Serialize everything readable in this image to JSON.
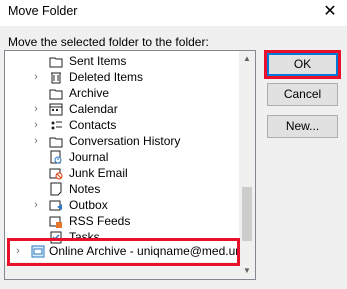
{
  "window": {
    "title": "Move Folder",
    "close_glyph": "✕"
  },
  "instruction": "Move the selected folder to the folder:",
  "folders": [
    {
      "label": "Sent Items",
      "icon": "folder-icon",
      "expandable": false
    },
    {
      "label": "Deleted Items",
      "icon": "trash-folder-icon",
      "expandable": true
    },
    {
      "label": "Archive",
      "icon": "folder-icon",
      "expandable": false
    },
    {
      "label": "Calendar",
      "icon": "calendar-icon",
      "expandable": true
    },
    {
      "label": "Contacts",
      "icon": "contacts-icon",
      "expandable": true
    },
    {
      "label": "Conversation History",
      "icon": "folder-icon",
      "expandable": true
    },
    {
      "label": "Journal",
      "icon": "journal-icon",
      "expandable": false
    },
    {
      "label": "Junk Email",
      "icon": "junk-email-icon",
      "expandable": false
    },
    {
      "label": "Notes",
      "icon": "notes-icon",
      "expandable": false
    },
    {
      "label": "Outbox",
      "icon": "outbox-icon",
      "expandable": true
    },
    {
      "label": "RSS Feeds",
      "icon": "rss-feeds-icon",
      "expandable": false
    },
    {
      "label": "Tasks",
      "icon": "tasks-icon",
      "expandable": false
    }
  ],
  "archive_item": {
    "label": "Online Archive - uniqname@med.umi",
    "icon": "online-archive-icon",
    "expandable": true
  },
  "buttons": {
    "ok": "OK",
    "cancel": "Cancel",
    "new": "New..."
  },
  "colors": {
    "highlight": "#e8102a",
    "folder": "#f5cd61"
  }
}
